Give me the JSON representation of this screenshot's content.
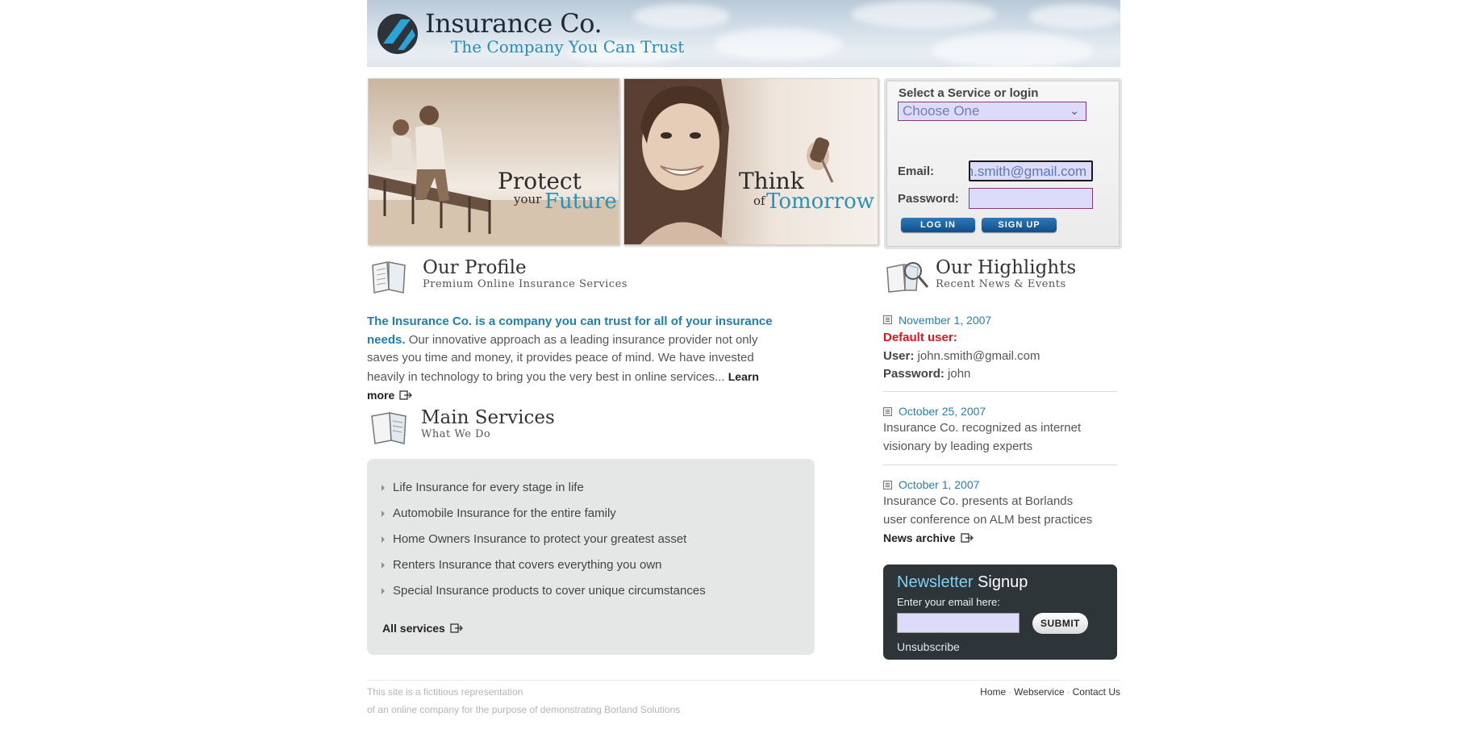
{
  "header": {
    "title": "Insurance Co.",
    "tagline": "The Company You Can Trust"
  },
  "banners": [
    {
      "line1": "Protect",
      "line2_small": "your",
      "line2_accent": "Future"
    },
    {
      "line1": "Think",
      "line2_small": "of",
      "line2_accent": "Tomorrow"
    }
  ],
  "login": {
    "title": "Select a Service or login",
    "select_value": "Choose One",
    "email_label": "Email:",
    "email_value": "john.smith@gmail.com",
    "password_label": "Password:",
    "password_value": "",
    "login_button": "LOG IN",
    "signup_button": "SIGN UP"
  },
  "profile": {
    "title": "Our Profile",
    "subtitle": "Premium Online Insurance Services",
    "lead": "The Insurance Co. is a company you can trust for all of your insurance needs.",
    "body": " Our innovative approach as a leading insurance provider not only saves you time and money, it provides peace of mind. We have invested heavily in technology to bring you the very best in online services... ",
    "more": "Learn more"
  },
  "services": {
    "title": "Main Services",
    "subtitle": "What We Do",
    "items": [
      "Life Insurance for every stage in life",
      "Automobile Insurance for the entire family",
      "Home Owners Insurance to protect your greatest asset",
      "Renters Insurance that covers everything you own",
      "Special Insurance products to cover unique circumstances"
    ],
    "all_link": "All services"
  },
  "highlights": {
    "title": "Our Highlights",
    "subtitle": "Recent News & Events",
    "news": [
      {
        "date": "November 1, 2007",
        "default_label": "Default user:",
        "user_label": "User:",
        "user_value": " john.smith@gmail.com",
        "pass_label": "Password:",
        "pass_value": " john"
      },
      {
        "date": "October 25, 2007",
        "text": "Insurance Co. recognized as internet visionary by leading experts"
      },
      {
        "date": "October 1, 2007",
        "text": "Insurance Co. presents at Borlands user conference on ALM best practices"
      }
    ],
    "archive_link": "News archive",
    "accent_red": "#e8131a"
  },
  "newsletter": {
    "title_a": "Newsletter",
    "title_b": " Signup",
    "label": "Enter your email here:",
    "input_value": "",
    "submit": "SUBMIT",
    "unsubscribe": "Unsubscribe"
  },
  "footer": {
    "line1": "This site is a fictitious representation",
    "line2": "of an online company for the purpose of demonstrating Borland Solutions",
    "links": [
      "Home",
      "Webservice",
      "Contact Us"
    ]
  }
}
